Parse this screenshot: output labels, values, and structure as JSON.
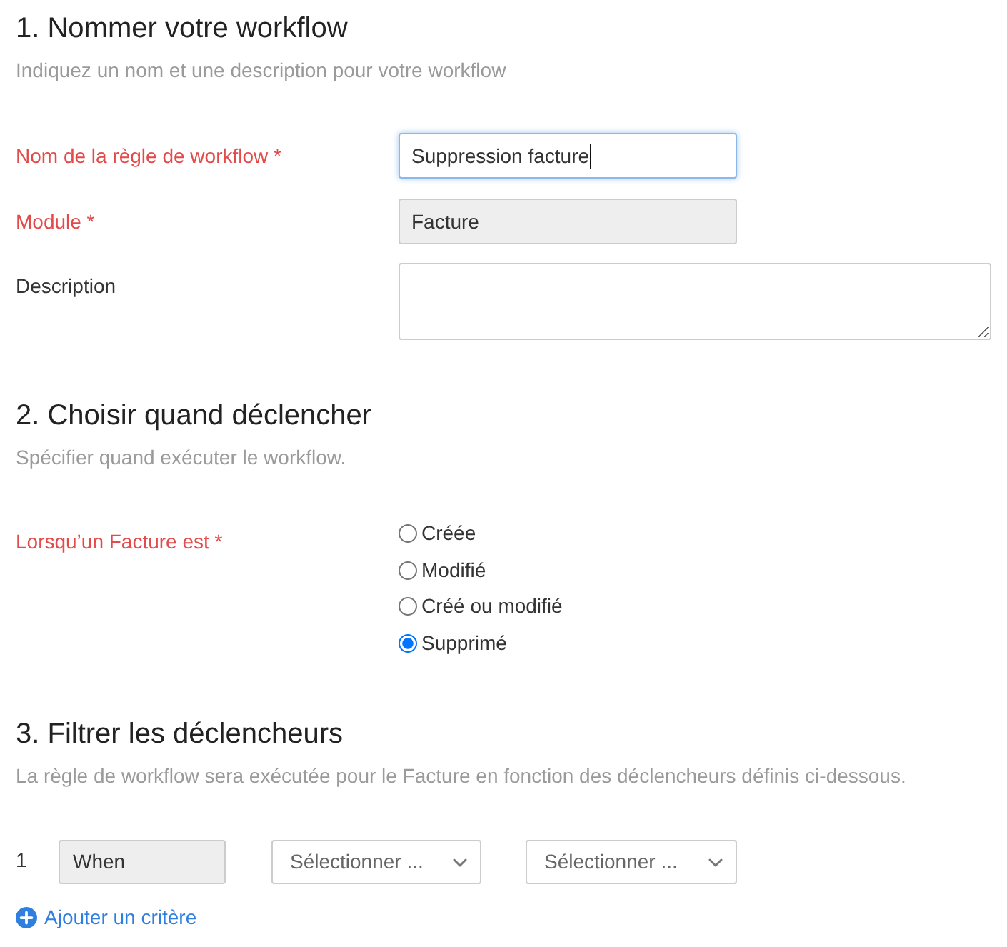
{
  "sections": [
    {
      "kind": "fields",
      "title": "1. Nommer votre workflow",
      "subtitle": "Indiquez un nom et une description pour votre workflow",
      "fields": [
        {
          "kind": "text",
          "label": "Nom de la règle de workflow *",
          "required": true,
          "value": "Suppression facture",
          "focused": true,
          "disabled": false
        },
        {
          "kind": "text",
          "label": "Module *",
          "required": true,
          "value": "Facture",
          "focused": false,
          "disabled": true
        },
        {
          "kind": "textarea",
          "label": "Description",
          "required": false
        }
      ]
    },
    {
      "kind": "radios",
      "title": "2. Choisir quand déclencher",
      "subtitle": "Spécifier quand exécuter le workflow.",
      "label": "Lorsqu’un Facture est *",
      "required": true,
      "options": [
        {
          "label": "Créée",
          "selected": false
        },
        {
          "label": "Modifié",
          "selected": false
        },
        {
          "label": "Créé ou modifié",
          "selected": false
        },
        {
          "label": "Supprimé",
          "selected": true
        }
      ]
    },
    {
      "kind": "criteria",
      "title": "3. Filtrer les déclencheurs",
      "subtitle": "La règle de workflow sera exécutée pour le Facture en fonction des déclencheurs définis ci-dessous.",
      "criteria": [
        {
          "number": "1",
          "field": "When",
          "operator": {
            "placeholder": "Sélectionner ..."
          },
          "value": {
            "placeholder": "Sélectionner ..."
          }
        }
      ],
      "add_link": "Ajouter un critère"
    }
  ]
}
